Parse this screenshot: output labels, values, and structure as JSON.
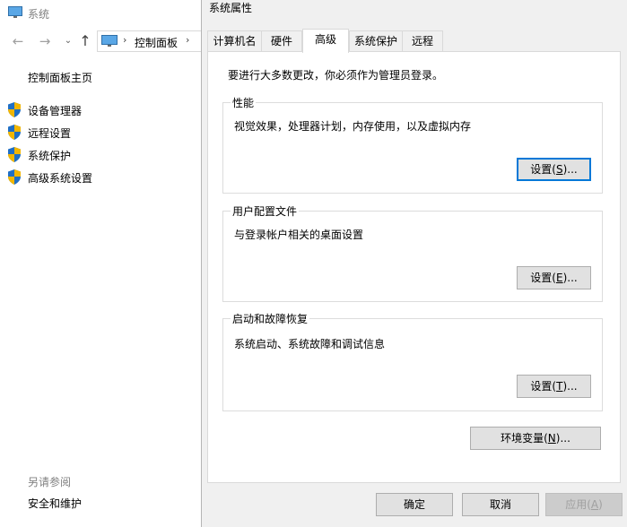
{
  "bg_window": {
    "title": "系统",
    "address_path": "控制面板",
    "sidebar_home": "控制面板主页",
    "links": [
      {
        "label": "设备管理器"
      },
      {
        "label": "远程设置"
      },
      {
        "label": "系统保护"
      },
      {
        "label": "高级系统设置"
      }
    ],
    "see_also_label": "另请参阅",
    "see_also_link": "安全和维护"
  },
  "dialog": {
    "title": "系统属性",
    "tabs": [
      {
        "label": "计算机名"
      },
      {
        "label": "硬件"
      },
      {
        "label": "高级"
      },
      {
        "label": "系统保护"
      },
      {
        "label": "远程"
      }
    ],
    "active_tab": "高级",
    "admin_note": "要进行大多数更改，你必须作为管理员登录。",
    "performance": {
      "title": "性能",
      "desc": "视觉效果，处理器计划，内存使用，以及虚拟内存",
      "button": {
        "pre": "设置(",
        "key": "S",
        "post": ")..."
      }
    },
    "profile": {
      "title": "用户配置文件",
      "desc": "与登录帐户相关的桌面设置",
      "button": {
        "pre": "设置(",
        "key": "E",
        "post": ")..."
      }
    },
    "startup": {
      "title": "启动和故障恢复",
      "desc": "系统启动、系统故障和调试信息",
      "button": {
        "pre": "设置(",
        "key": "T",
        "post": ")..."
      }
    },
    "env_button": {
      "pre": "环境变量(",
      "key": "N",
      "post": ")..."
    },
    "ok_label": "确定",
    "cancel_label": "取消",
    "apply": {
      "pre": "应用(",
      "key": "A",
      "post": ")"
    }
  },
  "colors": {
    "accent": "#0078d7",
    "shield_blue": "#1f6fc5",
    "shield_yellow": "#f2b600"
  }
}
